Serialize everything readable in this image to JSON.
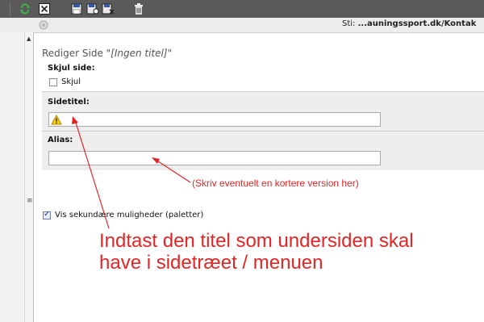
{
  "toolbar": {
    "icons": [
      "refresh-icon",
      "close-icon",
      "save-icon",
      "save-view-icon",
      "save-close-icon",
      "trash-icon"
    ],
    "bg": "#5a5a5a"
  },
  "pathbar": {
    "label": "Sti:",
    "path": "...auningssport.dk/Kontak"
  },
  "form": {
    "title_prefix": "Rediger Side \"",
    "title_value": "[Ingen titel]",
    "title_suffix": "\"",
    "hide_label": "Skjul side:",
    "hide_checkbox_label": "Skjul",
    "hide_checked": false,
    "page_title_label": "Sidetitel:",
    "page_title_value": "",
    "alias_label": "Alias:",
    "alias_value": "",
    "secondary_checkbox_label": "Vis sekundære muligheder (paletter)",
    "secondary_checked": true
  },
  "annotations": {
    "alias_note": "(Skriv eventuelt en kortere version her)",
    "title_note_line1": "Indtast den titel som undersiden skal",
    "title_note_line2": "have i sidetræet / menuen",
    "color": "#e32525"
  }
}
